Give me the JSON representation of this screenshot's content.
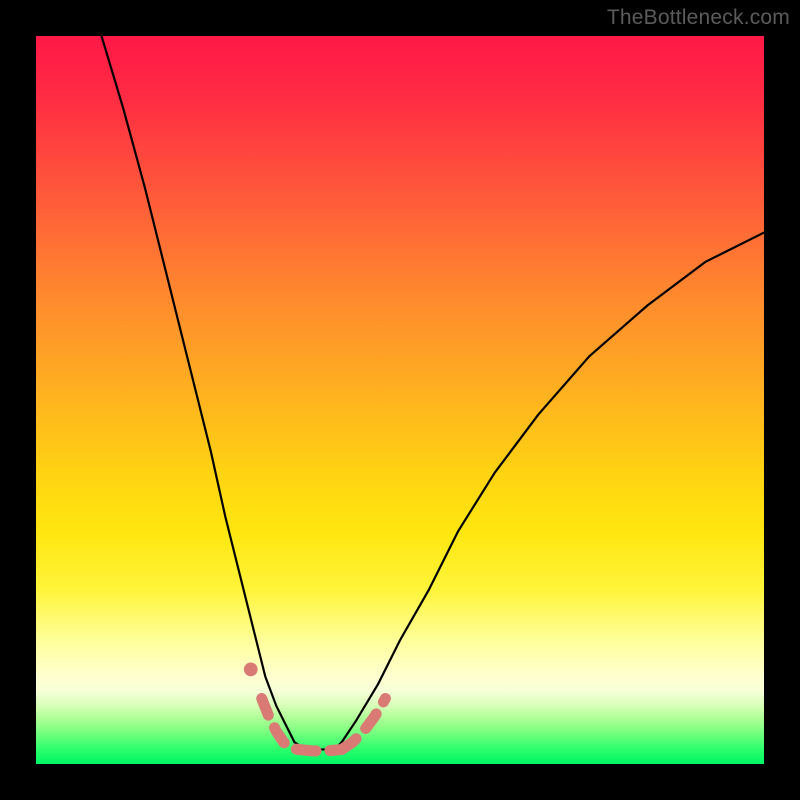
{
  "watermark": "TheBottleneck.com",
  "chart_data": {
    "type": "line",
    "title": "",
    "xlabel": "",
    "ylabel": "",
    "xlim": [
      0,
      100
    ],
    "ylim": [
      0,
      100
    ],
    "grid": false,
    "legend": false,
    "series": [
      {
        "name": "left-branch",
        "x": [
          9,
          12,
          15,
          18,
          21,
          24,
          26,
          28,
          30,
          31.5,
          33,
          34.5,
          35.5
        ],
        "y": [
          100,
          90,
          79,
          67,
          55,
          43,
          34,
          26,
          18,
          12,
          8,
          5,
          3
        ],
        "stroke": "#000000",
        "width": 2.2
      },
      {
        "name": "right-branch",
        "x": [
          42,
          44,
          47,
          50,
          54,
          58,
          63,
          69,
          76,
          84,
          92,
          100
        ],
        "y": [
          3,
          6,
          11,
          17,
          24,
          32,
          40,
          48,
          56,
          63,
          69,
          73
        ],
        "stroke": "#000000",
        "width": 2.2
      },
      {
        "name": "bottom-flat",
        "x": [
          35.5,
          37,
          39,
          41,
          42
        ],
        "y": [
          3,
          2,
          2,
          2,
          3
        ],
        "stroke": "#000000",
        "width": 2.2
      },
      {
        "name": "dash-left",
        "x": [
          31,
          32,
          33,
          34,
          35,
          36
        ],
        "y": [
          9,
          6.5,
          4.5,
          3,
          2.2,
          2
        ],
        "stroke": "#d97a74",
        "width": 11,
        "dash": true
      },
      {
        "name": "dash-bottom",
        "x": [
          36,
          38,
          40,
          42
        ],
        "y": [
          2,
          1.8,
          1.8,
          2
        ],
        "stroke": "#d97a74",
        "width": 11,
        "dash": true
      },
      {
        "name": "dash-right",
        "x": [
          42,
          43.5,
          45,
          46.5,
          48
        ],
        "y": [
          2,
          3,
          4.5,
          6.5,
          9
        ],
        "stroke": "#d97a74",
        "width": 11,
        "dash": true
      },
      {
        "name": "dot-upper-left",
        "x": [
          29.5
        ],
        "y": [
          13
        ],
        "stroke": "#d97a74",
        "width": 11,
        "dot": true
      }
    ],
    "colors": {
      "gradient_top": "#ff1947",
      "gradient_mid": "#ffe60f",
      "gradient_bottom": "#00f564",
      "curve": "#000000",
      "dash": "#d97a74",
      "frame": "#000000"
    }
  }
}
